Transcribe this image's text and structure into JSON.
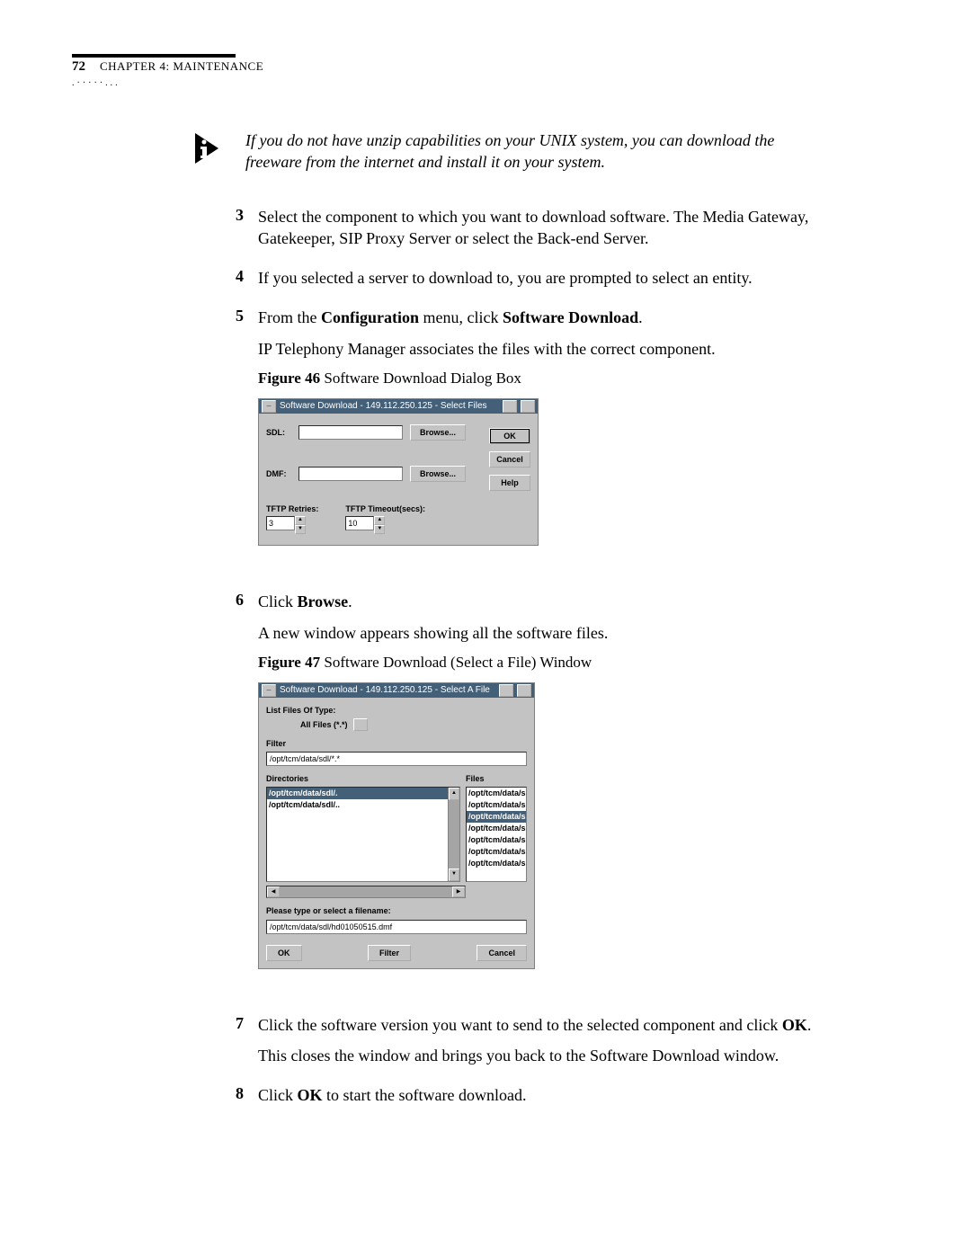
{
  "header": {
    "page_num": "72",
    "chapter_label": "CHAPTER 4: MAINTENANCE"
  },
  "note_text": "If you do not have unzip capabilities on your UNIX system, you can download the freeware from the internet and install it on your system.",
  "steps": {
    "s3": {
      "num": "3",
      "body1": "Select the component to which you want to download software. The Media Gateway, Gatekeeper, SIP Proxy Server or select the Back-end Server."
    },
    "s4": {
      "num": "4",
      "body1": "If you selected a server to download to, you are prompted to select an entity."
    },
    "s5": {
      "num": "5",
      "body_pre": "From the ",
      "bold1": "Configuration",
      "body_mid": " menu, click ",
      "bold2": "Software Download",
      "body_post": ".",
      "sub1": "IP Telephony Manager associates the files with the correct component.",
      "fig_label": "Figure 46",
      "fig_title": "  Software Download Dialog Box"
    },
    "s6": {
      "num": "6",
      "pre": "Click ",
      "bold1": "Browse",
      "post": ".",
      "sub1": "A new window appears showing all the software files.",
      "fig_label": "Figure 47",
      "fig_title": "  Software Download (Select a File) Window"
    },
    "s7": {
      "num": "7",
      "pre": "Click the software version you want to send to the selected component and click ",
      "bold1": "OK",
      "post": ".",
      "sub1": "This closes the window and brings you back to the Software Download window."
    },
    "s8": {
      "num": "8",
      "pre": "Click ",
      "bold1": "OK",
      "post": " to start the software download."
    }
  },
  "dlg1": {
    "title": "Software Download - 149.112.250.125 - Select Files",
    "sdl_lbl": "SDL:",
    "dmf_lbl": "DMF:",
    "browse_lbl": "Browse...",
    "retries_lbl": "TFTP Retries:",
    "retries_val": "3",
    "timeout_lbl": "TFTP Timeout(secs):",
    "timeout_val": "10",
    "ok": "OK",
    "cancel": "Cancel",
    "help": "Help"
  },
  "dlg2": {
    "title": "Software Download - 149.112.250.125 - Select A File",
    "list_type_lbl": "List Files Of Type:",
    "list_type_val": "All Files (*.*)",
    "filter_lbl": "Filter",
    "filter_val": "/opt/tcm/data/sdl/*.*",
    "dirs_lbl": "Directories",
    "dirs": [
      "/opt/tcm/data/sdl/.",
      "/opt/tcm/data/sdl/.."
    ],
    "files_lbl": "Files",
    "files": [
      "/opt/tcm/data/s",
      "/opt/tcm/data/s",
      "/opt/tcm/data/s",
      "/opt/tcm/data/s",
      "/opt/tcm/data/s",
      "/opt/tcm/data/s",
      "/opt/tcm/data/s"
    ],
    "files_sel_index": 2,
    "filename_lbl": "Please type or select a filename:",
    "filename_val": "/opt/tcm/data/sdl/hd01050515.dmf",
    "ok": "OK",
    "filter_btn": "Filter",
    "cancel": "Cancel"
  }
}
